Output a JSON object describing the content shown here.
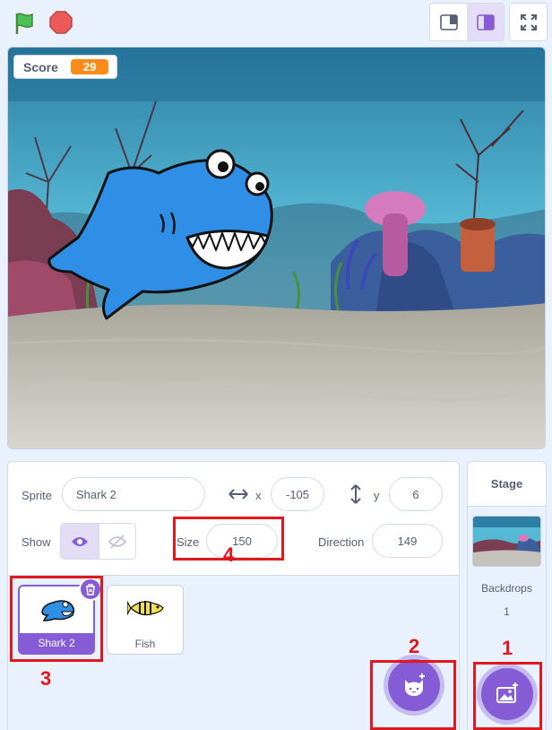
{
  "colors": {
    "accent": "#855cd6",
    "monitor_value": "#ff8c1a",
    "annotation": "#e3171e",
    "pane_bg": "#e9f1fc"
  },
  "toolbar": {
    "green_flag_icon": "green-flag-icon",
    "stop_icon": "stop-sign-icon",
    "small_stage_icon": "small-stage-icon",
    "large_stage_icon": "large-stage-icon",
    "fullscreen_icon": "fullscreen-icon"
  },
  "stage": {
    "monitor": {
      "label": "Score",
      "value": "29"
    }
  },
  "sprite_info": {
    "sprite_label": "Sprite",
    "sprite_name": "Shark 2",
    "x_label": "x",
    "x_value": "-105",
    "y_label": "y",
    "y_value": "6",
    "show_label": "Show",
    "size_label": "Size",
    "size_value": "150",
    "direction_label": "Direction",
    "direction_value": "149"
  },
  "sprites": [
    {
      "name": "Shark 2",
      "selected": true
    },
    {
      "name": "Fish",
      "selected": false
    }
  ],
  "stage_pane": {
    "title": "Stage",
    "backdrops_label": "Backdrops",
    "backdrops_count": "1"
  },
  "annotations": [
    "1",
    "2",
    "3",
    "4"
  ]
}
